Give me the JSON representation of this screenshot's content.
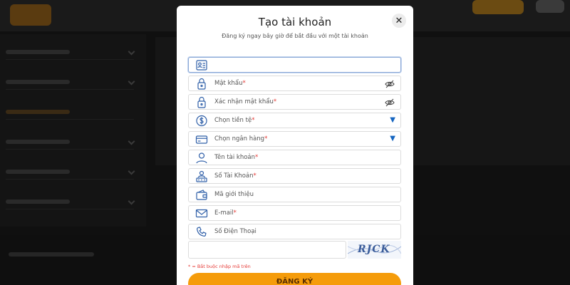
{
  "modal": {
    "title": "Tạo tài khoản",
    "subtitle": "Đăng ký ngay bây giờ để bắt đầu với một tài khoản",
    "close_label": "✕"
  },
  "fields": {
    "username": {
      "placeholder": "",
      "icon": "id-card-icon"
    },
    "password": {
      "label": "Mật khẩu",
      "required": "*",
      "icon": "lock-icon",
      "toggle_icon": "eye-off-icon"
    },
    "confirm_password": {
      "label": "Xác nhận mật khẩu",
      "required": "*",
      "icon": "lock-icon",
      "toggle_icon": "eye-off-icon"
    },
    "currency": {
      "label": "Chọn tiền tệ",
      "required": "*",
      "icon": "dollar-circle-icon",
      "caret": "▼"
    },
    "bank": {
      "label": "Chọn ngân hàng",
      "required": "*",
      "icon": "credit-card-icon",
      "caret": "▼"
    },
    "account_name": {
      "label": "Tên tài khoản",
      "required": "*",
      "icon": "user-icon"
    },
    "account_number": {
      "label": "Số Tài Khoản",
      "required": "*",
      "icon": "bank-user-icon"
    },
    "referral": {
      "label": "Mã giới thiệu",
      "icon": "wallet-icon"
    },
    "email": {
      "label": "E-mail",
      "required": "*",
      "icon": "mail-icon"
    },
    "phone": {
      "label": "Số Điện Thoại",
      "icon": "phone-icon"
    }
  },
  "captcha": {
    "code": "RJCK"
  },
  "note": "* = Bắt buộc nhập mã trên",
  "submit_label": "ĐĂNG KÝ",
  "colors": {
    "accent": "#f59c0b",
    "required": "#e53935",
    "caret": "#1565c0",
    "focus_border": "#8aa8d6"
  }
}
